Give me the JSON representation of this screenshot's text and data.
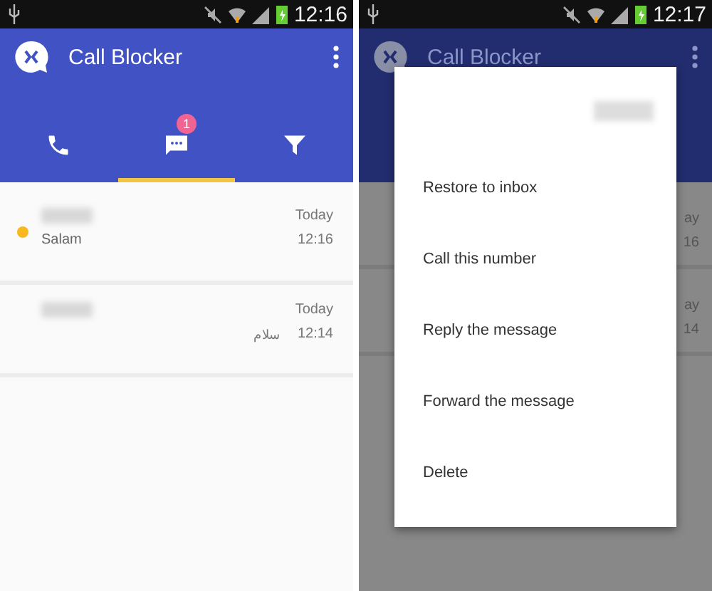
{
  "screens": [
    {
      "status_bar": {
        "time": "12:16"
      },
      "app_bar": {
        "title": "Call Blocker"
      },
      "tabs": [
        {
          "kind": "calls",
          "selected": false
        },
        {
          "kind": "messages",
          "selected": true,
          "badge": "1"
        },
        {
          "kind": "filter",
          "selected": false
        }
      ],
      "messages": [
        {
          "unread": true,
          "preview": "Salam",
          "date": "Today",
          "time": "12:16"
        },
        {
          "unread": false,
          "preview": "سلام",
          "date": "Today",
          "time": "12:14"
        }
      ]
    },
    {
      "status_bar": {
        "time": "12:17"
      },
      "app_bar": {
        "title": "Call Blocker"
      },
      "list_fragments": [
        {
          "date": "ay",
          "time": "16"
        },
        {
          "date": "ay",
          "time": "14"
        }
      ],
      "dialog": {
        "items": [
          "Restore to inbox",
          "Call this number",
          "Reply the message",
          "Forward the message",
          "Delete"
        ]
      }
    }
  ]
}
